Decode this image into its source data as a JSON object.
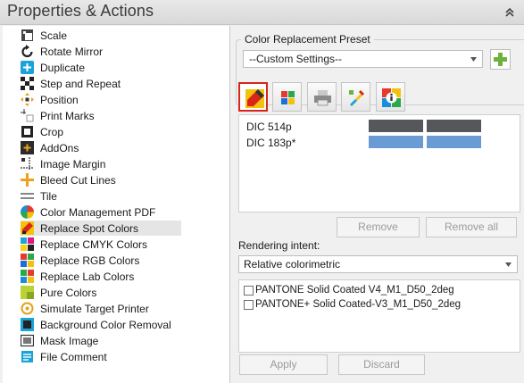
{
  "header": {
    "title": "Properties & Actions"
  },
  "sidebar": {
    "items": [
      {
        "label": "Scale",
        "icon": "scale-icon"
      },
      {
        "label": "Rotate Mirror",
        "icon": "rotate-mirror-icon"
      },
      {
        "label": "Duplicate",
        "icon": "duplicate-icon"
      },
      {
        "label": "Step and Repeat",
        "icon": "step-and-repeat-icon"
      },
      {
        "label": "Position",
        "icon": "position-icon"
      },
      {
        "label": "Print Marks",
        "icon": "print-marks-icon"
      },
      {
        "label": "Crop",
        "icon": "crop-icon"
      },
      {
        "label": "AddOns",
        "icon": "addons-icon"
      },
      {
        "label": "Image Margin",
        "icon": "image-margin-icon"
      },
      {
        "label": "Bleed Cut Lines",
        "icon": "bleed-cut-lines-icon"
      },
      {
        "label": "Tile",
        "icon": "tile-icon"
      },
      {
        "label": "Color Management PDF",
        "icon": "color-management-pdf-icon"
      },
      {
        "label": "Replace Spot Colors",
        "icon": "replace-spot-colors-icon",
        "selected": true
      },
      {
        "label": "Replace CMYK Colors",
        "icon": "replace-cmyk-colors-icon"
      },
      {
        "label": "Replace RGB Colors",
        "icon": "replace-rgb-colors-icon"
      },
      {
        "label": "Replace Lab Colors",
        "icon": "replace-lab-colors-icon"
      },
      {
        "label": "Pure Colors",
        "icon": "pure-colors-icon"
      },
      {
        "label": "Simulate Target Printer",
        "icon": "simulate-target-printer-icon"
      },
      {
        "label": "Background Color Removal",
        "icon": "background-color-removal-icon"
      },
      {
        "label": "Mask Image",
        "icon": "mask-image-icon"
      },
      {
        "label": "File Comment",
        "icon": "file-comment-icon"
      }
    ]
  },
  "preset": {
    "group_label": "Color Replacement Preset",
    "selected": "--Custom Settings--"
  },
  "toolbar": [
    {
      "icon": "color-picker-icon",
      "active": true
    },
    {
      "icon": "color-swatches-icon",
      "active": false
    },
    {
      "icon": "printer-icon",
      "active": false
    },
    {
      "icon": "eyedropper-edit-icon",
      "active": false
    },
    {
      "icon": "info-icon",
      "active": false
    }
  ],
  "colors": [
    {
      "name": "DIC 514p",
      "swatch1": "#55575a",
      "swatch2": "#55575a"
    },
    {
      "name": "DIC 183p*",
      "swatch1": "#6b9bd4",
      "swatch2": "#6b9bd4"
    }
  ],
  "buttons": {
    "remove": "Remove",
    "remove_all": "Remove all",
    "apply": "Apply",
    "discard": "Discard"
  },
  "rendering": {
    "label": "Rendering intent:",
    "selected": "Relative colorimetric"
  },
  "profiles": [
    {
      "label": "PANTONE Solid Coated V4_M1_D50_2deg"
    },
    {
      "label": "PANTONE+ Solid Coated-V3_M1_D50_2deg"
    }
  ]
}
